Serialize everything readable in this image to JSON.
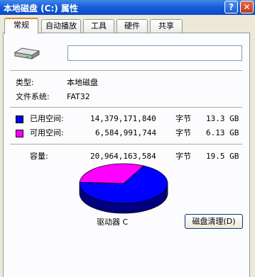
{
  "window": {
    "title": "本地磁盘 (C:) 属性",
    "help_glyph": "?",
    "close_glyph": "✕"
  },
  "tabs": [
    {
      "label": "常规",
      "active": true
    },
    {
      "label": "自动播放",
      "active": false
    },
    {
      "label": "工具",
      "active": false
    },
    {
      "label": "硬件",
      "active": false
    },
    {
      "label": "共享",
      "active": false
    }
  ],
  "general": {
    "drive_icon": "hard-drive-icon",
    "name_value": "",
    "type_label": "类型:",
    "type_value": "本地磁盘",
    "fs_label": "文件系统:",
    "fs_value": "FAT32",
    "used": {
      "label": "已用空间:",
      "bytes": "14,379,171,840",
      "unit": "字节",
      "size": "13.3 GB",
      "color": "#0000ff"
    },
    "free": {
      "label": "可用空间:",
      "bytes": "6,584,991,744",
      "unit": "字节",
      "size": "6.13 GB",
      "color": "#ff00ff"
    },
    "capacity": {
      "label": "容量:",
      "bytes": "20,964,163,584",
      "unit": "字节",
      "size": "19.5 GB"
    },
    "drive_label": "驱动器 C",
    "cleanup_button": "磁盘清理(D)"
  },
  "chart_data": {
    "type": "pie",
    "categories": [
      "已用空间",
      "可用空间"
    ],
    "values": [
      14379171840,
      6584991744
    ],
    "colors": [
      "#0000ff",
      "#ff00ff"
    ]
  }
}
